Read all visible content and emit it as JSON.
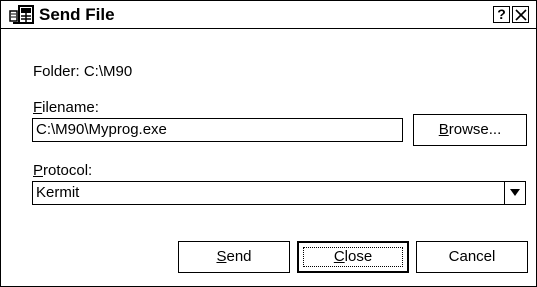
{
  "window": {
    "title": "Send File",
    "help_label": "?"
  },
  "icons": {
    "app": "send-file-app-icon",
    "close": "close-icon",
    "dropdown": "chevron-down-icon"
  },
  "form": {
    "folder_text": "Folder:  C:\\M90",
    "filename": {
      "label_first": "F",
      "label_rest": "ilename:",
      "value": "C:\\M90\\Myprog.exe"
    },
    "protocol": {
      "label_first": "P",
      "label_rest": "rotocol:",
      "selected": "Kermit"
    }
  },
  "buttons": {
    "browse": {
      "first": "B",
      "rest": "rowse..."
    },
    "send": {
      "first": "S",
      "rest": "end"
    },
    "close": {
      "first": "C",
      "rest": "lose"
    },
    "cancel": {
      "label": "Cancel"
    }
  }
}
